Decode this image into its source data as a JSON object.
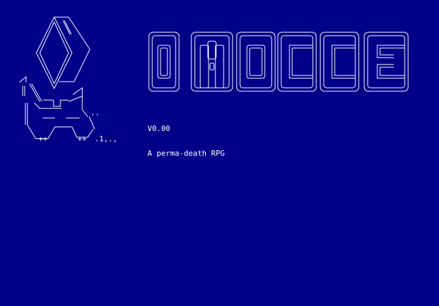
{
  "game": {
    "title_logo_text": "OMOCCE",
    "version": "V0.00",
    "tagline": "A perma-death RPG",
    "background_color": "#000088",
    "text_color": "#ffffff",
    "scatter_text": ".1,.,",
    "feet_left": "++",
    "feet_right": "++"
  }
}
